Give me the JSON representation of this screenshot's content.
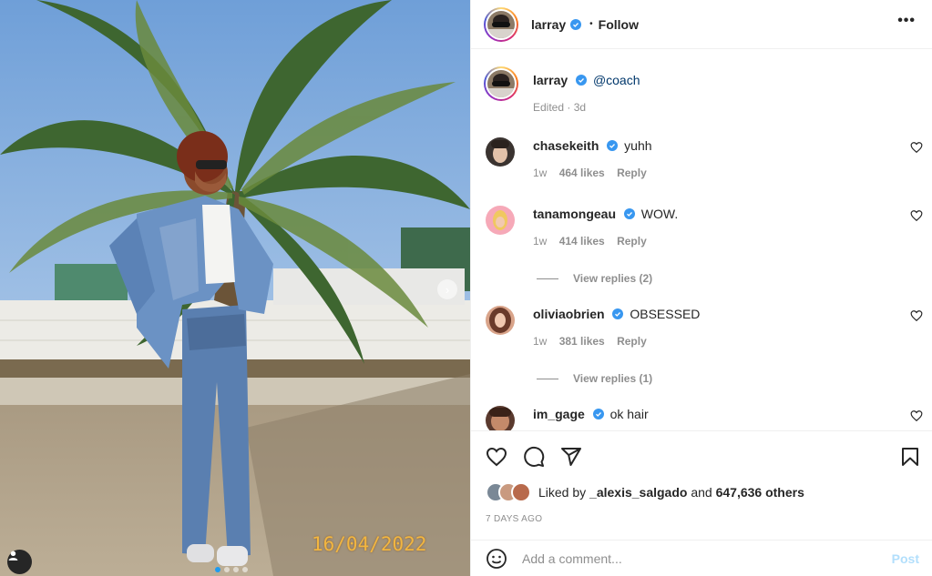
{
  "photo": {
    "date_stamp": "16/04/2022",
    "user_tag_icon": "user-icon",
    "carousel_next_icon": "chevron-right-icon",
    "carousel": {
      "count": 4,
      "active_index": 0
    }
  },
  "header": {
    "username": "larray",
    "separator": "•",
    "follow_label": "Follow",
    "more_icon": "more-horizontal-icon",
    "more_label": "•••"
  },
  "caption": {
    "username": "larray",
    "mention": "@coach",
    "meta": "Edited · 3d"
  },
  "comments": [
    {
      "username": "chasekeith",
      "text": "yuhh",
      "age": "1w",
      "likes": "464 likes",
      "reply": "Reply"
    },
    {
      "username": "tanamongeau",
      "text": "WOW.",
      "age": "1w",
      "likes": "414 likes",
      "reply": "Reply",
      "view_replies": "View replies (2)"
    },
    {
      "username": "oliviaobrien",
      "text": "OBSESSED",
      "age": "1w",
      "likes": "381 likes",
      "reply": "Reply",
      "view_replies": "View replies (1)"
    },
    {
      "username": "im_gage",
      "text": "ok hair"
    }
  ],
  "actions": {
    "like_icon": "heart-icon",
    "comment_icon": "comment-icon",
    "share_icon": "share-icon",
    "save_icon": "bookmark-icon"
  },
  "likes": {
    "prefix": "Liked by ",
    "user": "_alexis_salgado",
    "middle": " and ",
    "others": "647,636 others"
  },
  "posted_ago": "7 DAYS AGO",
  "add_comment": {
    "emoji_icon": "smiley-icon",
    "placeholder": "Add a comment...",
    "post_label": "Post"
  },
  "colors": {
    "verified": "#3897f0",
    "post_disabled": "#b2dffc",
    "mention": "#00376b",
    "carousel_active": "#1e9bf0"
  }
}
